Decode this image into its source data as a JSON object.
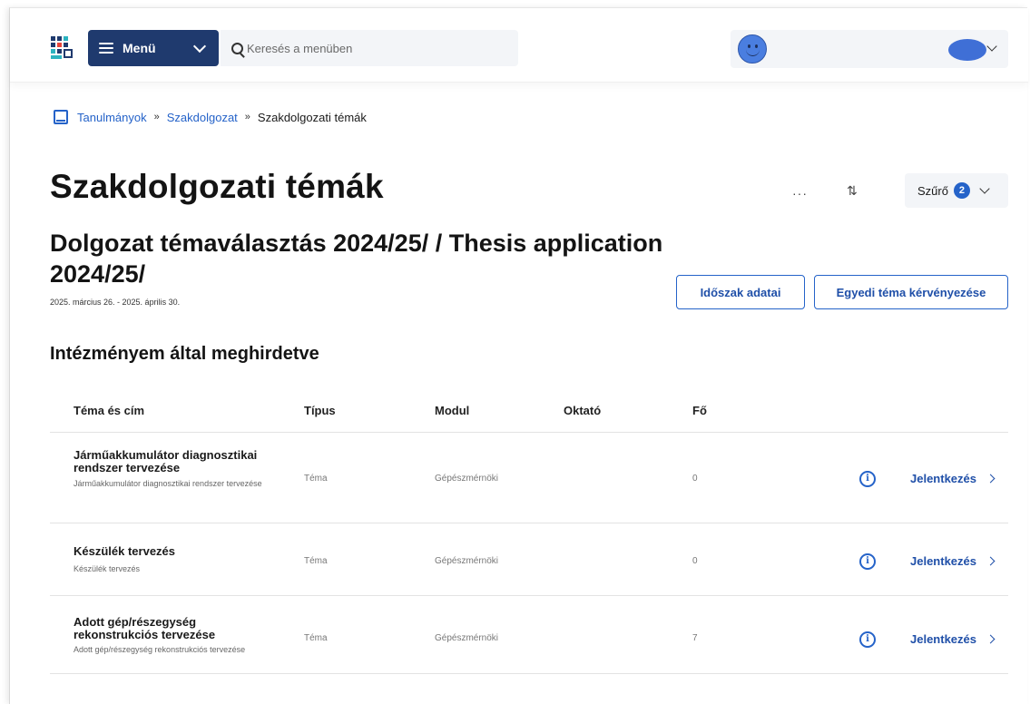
{
  "header": {
    "menu_label": "Menü",
    "search_placeholder": "Keresés a menüben"
  },
  "breadcrumb": {
    "items": [
      "Tanulmányok",
      "Szakdolgozat"
    ],
    "separator": "»",
    "current": "Szakdolgozati témák"
  },
  "page": {
    "title": "Szakdolgozati témák",
    "period_title": "Dolgozat témaválasztás 2024/25/   / Thesis application 2024/25/",
    "period_dates": "2025. március 26. - 2025. április 30.",
    "more_label": "···",
    "sort_label": "⇅",
    "filter_label": "Szűrő",
    "filter_count": "2",
    "btn_period": "Időszak adatai",
    "btn_custom": "Egyedi téma kérvényezése",
    "section_title": "Intézményem által meghirdetve"
  },
  "table": {
    "headers": {
      "title": "Téma és cím",
      "type": "Típus",
      "module": "Modul",
      "teacher": "Oktató",
      "count": "Fő"
    },
    "rows": [
      {
        "title": "Járműakkumulátor diagnosztikai rendszer tervezése",
        "subtitle": "Járműakkumulátor diagnosztikai rendszer tervezése",
        "type": "Téma",
        "module": "Gépészmérnöki",
        "count": "0",
        "info": "i",
        "apply": "Jelentkezés"
      },
      {
        "title": "Készülék tervezés",
        "subtitle": "Készülék tervezés",
        "type": "Téma",
        "module": "Gépészmérnöki",
        "count": "0",
        "info": "i",
        "apply": "Jelentkezés"
      },
      {
        "title": "Adott gép/részegység rekonstrukciós tervezése",
        "subtitle": "Adott gép/részegység rekonstrukciós tervezése",
        "type": "Téma",
        "module": "Gépészmérnöki",
        "count": "7",
        "info": "i",
        "apply": "Jelentkezés"
      }
    ]
  },
  "colors": {
    "accent": "#2563c9",
    "menu_bg": "#1f3a6e"
  }
}
